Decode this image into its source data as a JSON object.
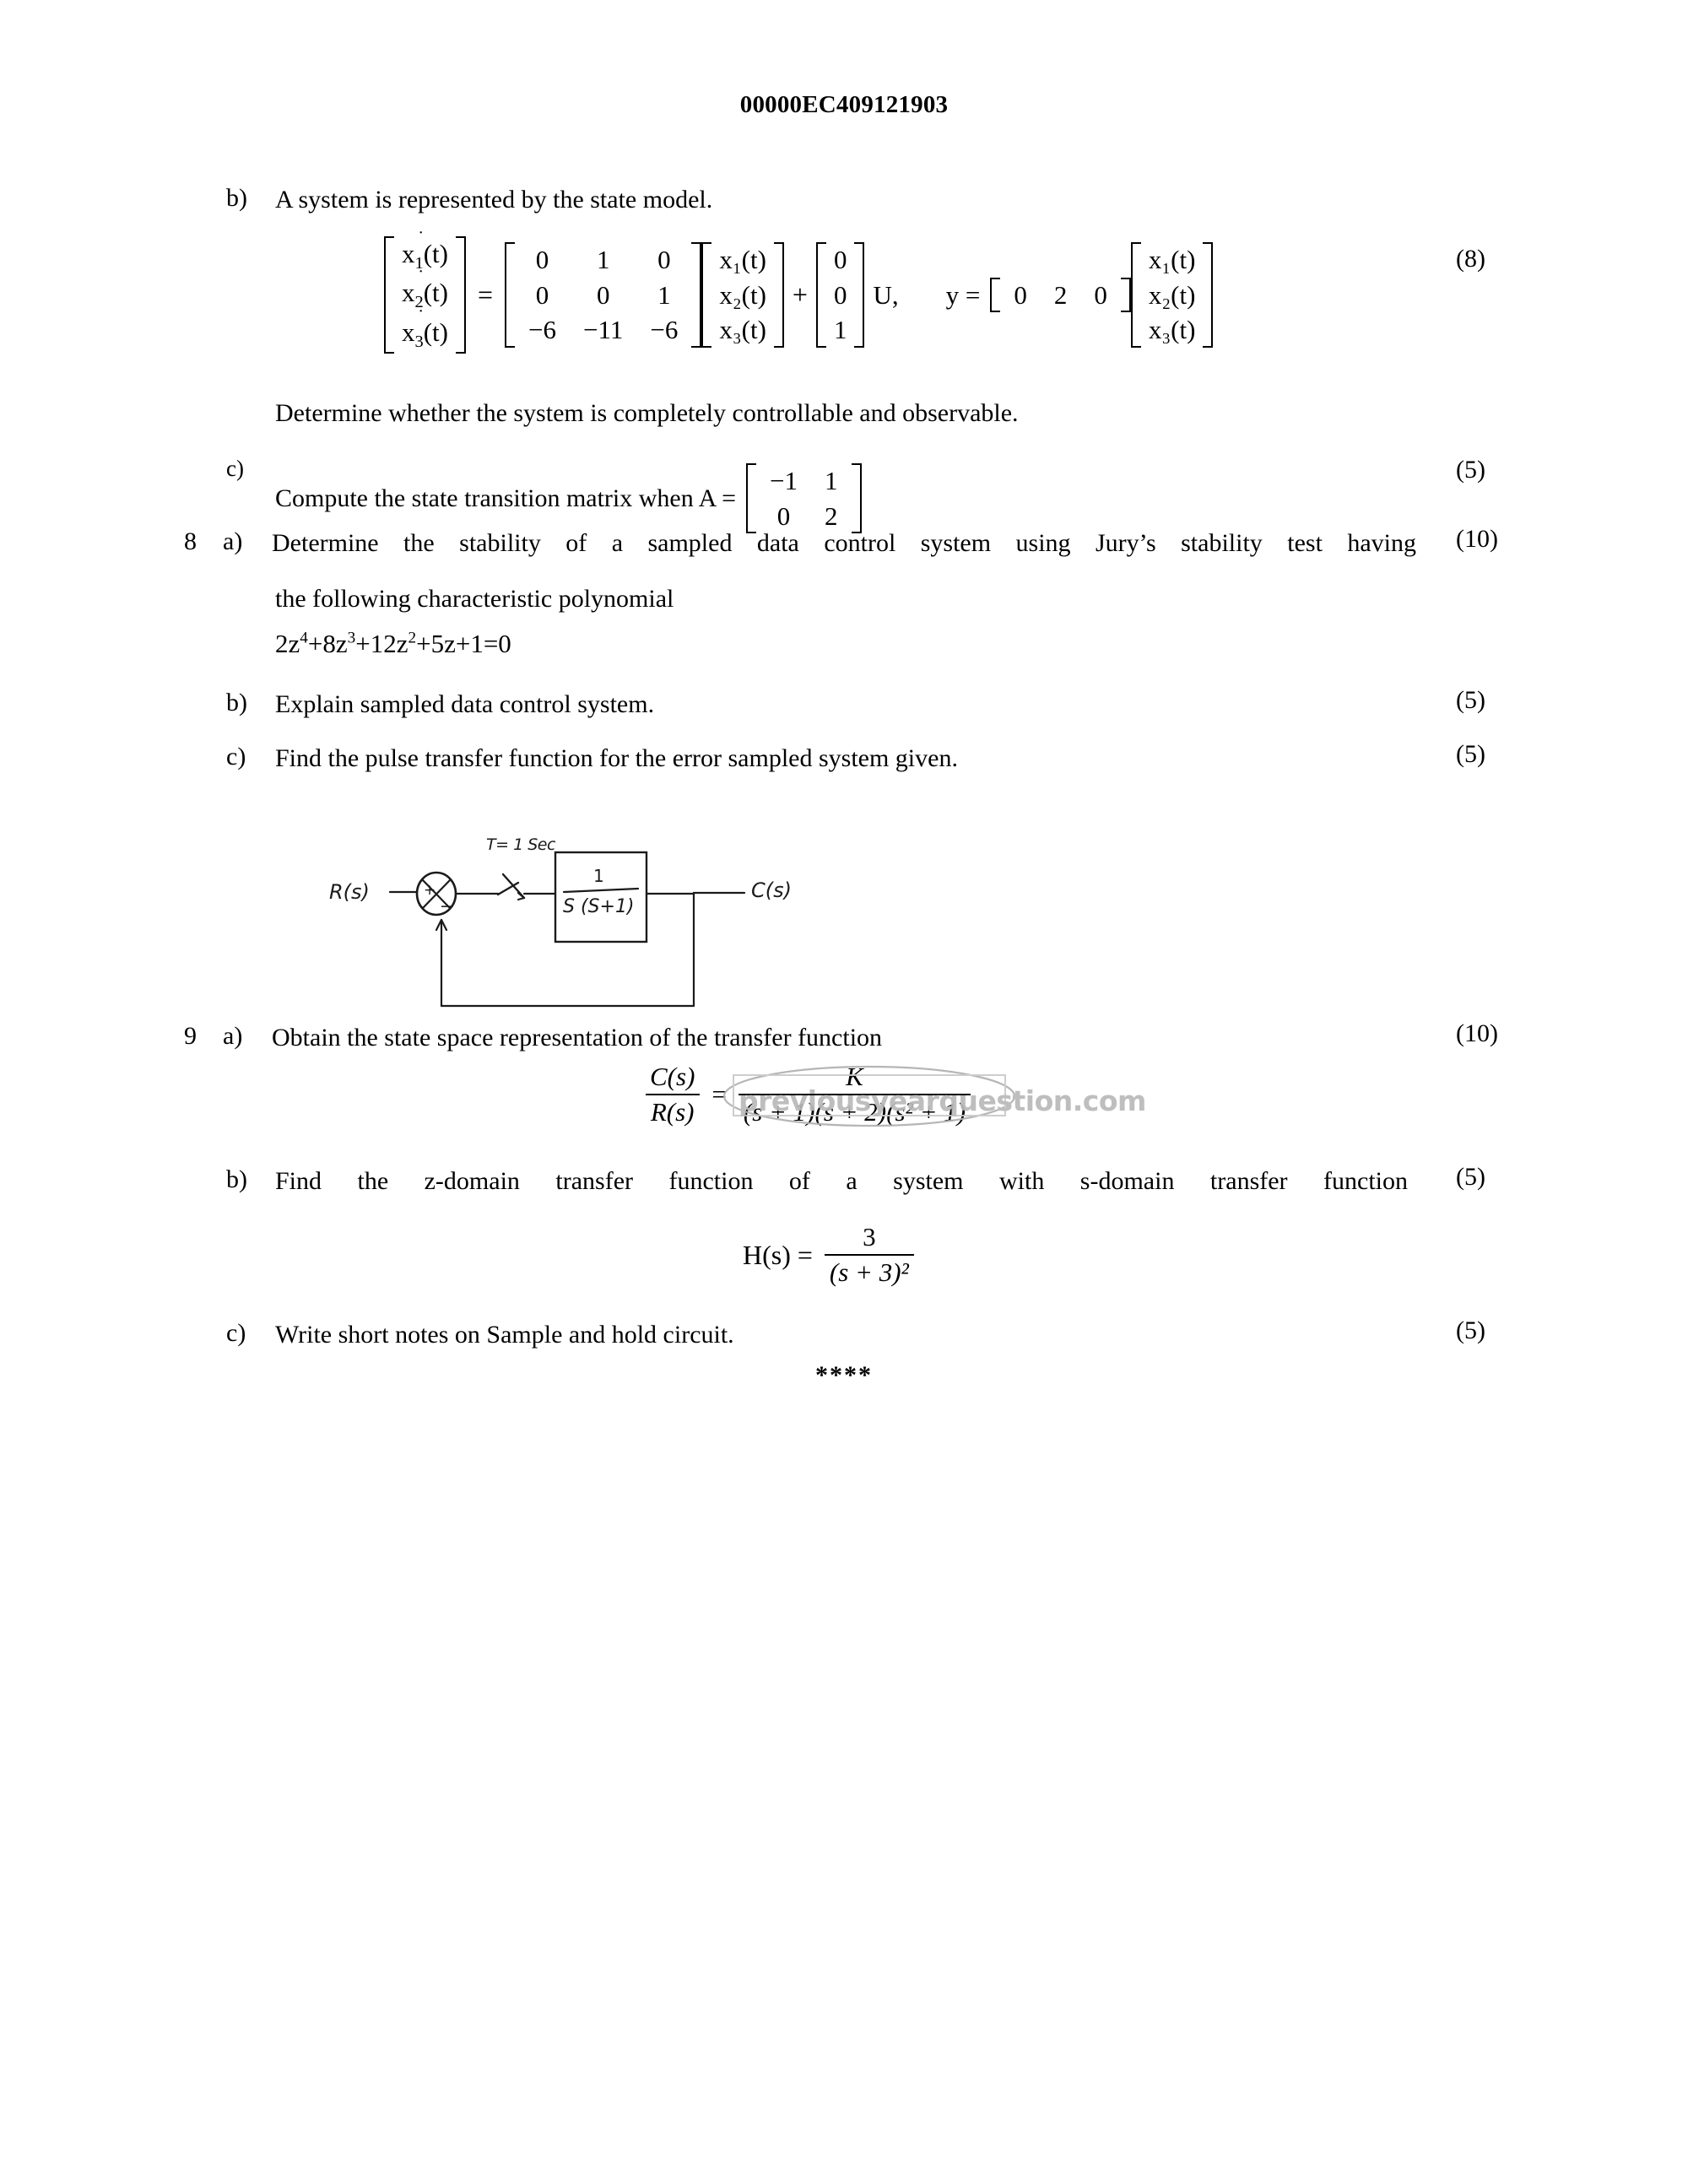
{
  "header": {
    "code": "00000EC409121903"
  },
  "watermark": {
    "text": "previousyearquestion.com"
  },
  "questions": [
    {
      "number": "",
      "letter": "b)",
      "text": "A system is represented by the state model.",
      "marks": "(8)"
    },
    {
      "number": "",
      "letter": "",
      "text": "Determine whether the system is completely controllable and observable.",
      "marks": ""
    },
    {
      "number": "",
      "letter": "c)",
      "text": "Compute the state transition matrix when A =",
      "marks": "(5)"
    },
    {
      "number": "8",
      "letter": "a)",
      "text": "Determine the stability of a sampled data control system using Jury’s stability test having",
      "text_line2": "the following characteristic polynomial",
      "marks": "(10)"
    },
    {
      "number": "",
      "letter": "b)",
      "text": "Explain sampled data control system.",
      "marks": "(5)"
    },
    {
      "number": "",
      "letter": "c)",
      "text": "Find the pulse transfer function for the error sampled system given.",
      "marks": "(5)"
    },
    {
      "number": "9",
      "letter": "a)",
      "text": "Obtain the state space representation of the transfer function",
      "marks": "(10)"
    },
    {
      "number": "",
      "letter": "b)",
      "text": "Find the z-domain transfer function of a system with s-domain transfer function",
      "marks": "(5)"
    },
    {
      "number": "",
      "letter": "c)",
      "text": "Write short notes on Sample and hold circuit.",
      "marks": "(5)"
    }
  ],
  "state_model": {
    "lhs_vector": [
      "x₁(t)",
      "x₂(t)",
      "x₃(t)"
    ],
    "lhs_labels": [
      "x",
      "x",
      "x"
    ],
    "lhs_subs": [
      "1",
      "2",
      "3"
    ],
    "equals": "=",
    "A_matrix": [
      [
        "0",
        "1",
        "0"
      ],
      [
        "0",
        "0",
        "1"
      ],
      [
        "−6",
        "−11",
        "−6"
      ]
    ],
    "state_vector": [
      "x₁(t)",
      "x₂(t)",
      "x₃(t)"
    ],
    "plus": "+",
    "B_vector": [
      "0",
      "0",
      "1"
    ],
    "input": "U,",
    "output_eq": "y =",
    "C_matrix": [
      "0",
      "2",
      "0"
    ],
    "output_vector": [
      "x₁(t)",
      "x₂(t)",
      "x₃(t)"
    ]
  },
  "stm_matrix": {
    "rows": [
      [
        "−1",
        "1"
      ],
      [
        "0",
        "2"
      ]
    ]
  },
  "polynomial": {
    "terms": "2z⁴+8z³+12z²+5z+1=0",
    "parts": [
      {
        "base": "2z",
        "sup": "4"
      },
      {
        "base": "+8z",
        "sup": "3"
      },
      {
        "base": "+12z",
        "sup": "2"
      },
      {
        "base": "+5z+1=0",
        "sup": ""
      }
    ]
  },
  "block_diagram": {
    "input_label": "R(s)",
    "output_label": "C(s)",
    "sampler_label": "T= 1 Sec",
    "summing_plus": "+",
    "summing_minus": "−",
    "block_numerator": "1",
    "block_denominator": "S (S+1)"
  },
  "transfer_function_9a": {
    "lhs_num": "C(s)",
    "lhs_den": "R(s)",
    "equals": "=",
    "rhs_num": "K",
    "rhs_den": "(s + 1)(s + 2)(s² + 1)"
  },
  "transfer_function_9b": {
    "lhs": "H(s) =",
    "num": "3",
    "den": "(s + 3)²"
  },
  "footer": {
    "stars": "****"
  }
}
